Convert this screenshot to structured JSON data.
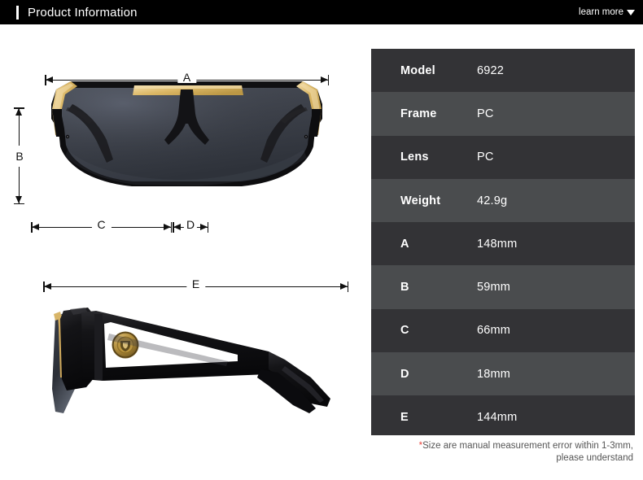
{
  "header": {
    "title": "Product Information",
    "learn_more_label": "learn more",
    "caret_icon": "chevron-down-icon",
    "background_color": "#000000",
    "accent_color": "#ffffff"
  },
  "product": {
    "front_view_alt": "sunglasses-front-view",
    "side_view_alt": "sunglasses-side-view",
    "frame_color": "#0d0d0f",
    "metal_color": "#d9b45f",
    "lens_color": "#3c4049",
    "emblem_color": "#b08c3a"
  },
  "dimension_callouts": [
    {
      "id": "A",
      "label": "A",
      "orientation": "horizontal",
      "view": "front"
    },
    {
      "id": "B",
      "label": "B",
      "orientation": "vertical",
      "view": "front"
    },
    {
      "id": "C",
      "label": "C",
      "orientation": "horizontal",
      "view": "front"
    },
    {
      "id": "D",
      "label": "D",
      "orientation": "horizontal",
      "view": "front"
    },
    {
      "id": "E",
      "label": "E",
      "orientation": "horizontal",
      "view": "side"
    }
  ],
  "spec_table": {
    "row_color_dark": "#333336",
    "row_color_light": "#4a4c4e",
    "rows": [
      {
        "key": "Model",
        "value": "6922"
      },
      {
        "key": "Frame",
        "value": "PC"
      },
      {
        "key": "Lens",
        "value": "PC"
      },
      {
        "key": "Weight",
        "value": "42.9g"
      },
      {
        "key": "A",
        "value": "148mm"
      },
      {
        "key": "B",
        "value": "59mm"
      },
      {
        "key": "C",
        "value": "66mm"
      },
      {
        "key": "D",
        "value": "18mm"
      },
      {
        "key": "E",
        "value": "144mm"
      }
    ]
  },
  "footnote": {
    "star": "*",
    "line1": "Size are manual measurement error within 1-3mm,",
    "line2": "please understand",
    "star_color": "#e8453c"
  }
}
